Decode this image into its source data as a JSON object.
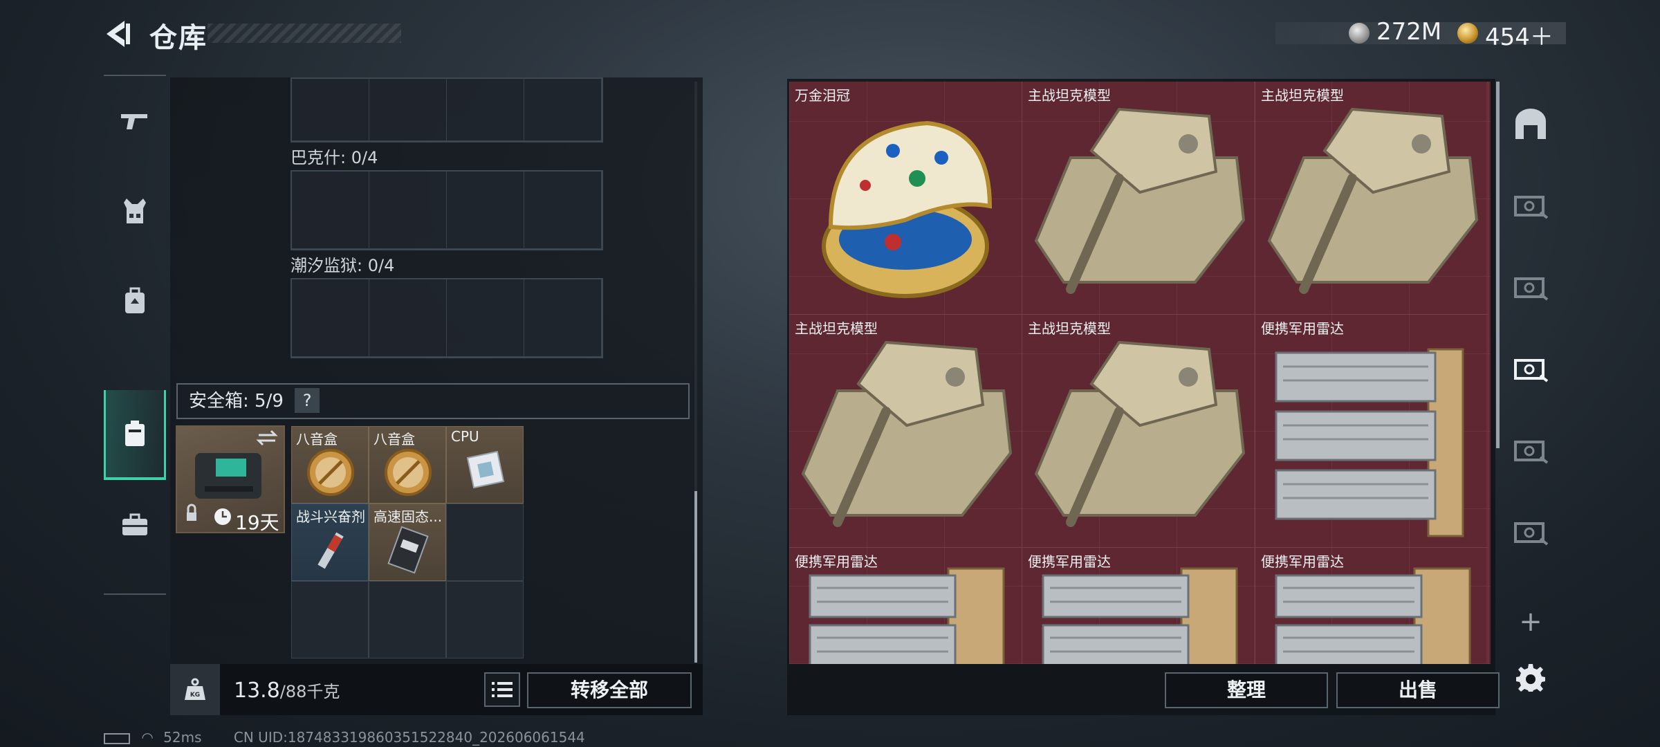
{
  "header": {
    "title": "仓库",
    "currencies": {
      "silver": "272M",
      "gold": "454＋"
    }
  },
  "left_panel": {
    "grids": [
      {
        "label": "巴克什: 0/4"
      },
      {
        "label": "潮汐监狱: 0/4"
      }
    ],
    "safe_box": {
      "label": "安全箱: 5/9",
      "help": "?",
      "days": "19天",
      "items": [
        {
          "name": "八音盒"
        },
        {
          "name": "八音盒"
        },
        {
          "name": "CPU"
        },
        {
          "name": "战斗兴奋剂"
        },
        {
          "name": "高速固态..."
        }
      ]
    },
    "weight": {
      "current": "13.8",
      "max": "/88千克"
    },
    "transfer_all_label": "转移全部"
  },
  "stash": {
    "items": [
      {
        "name": "万金泪冠"
      },
      {
        "name": "主战坦克模型"
      },
      {
        "name": "主战坦克模型"
      },
      {
        "name": "主战坦克模型"
      },
      {
        "name": "主战坦克模型"
      },
      {
        "name": "便携军用雷达"
      },
      {
        "name": "便携军用雷达"
      },
      {
        "name": "便携军用雷达"
      },
      {
        "name": "便携军用雷达"
      }
    ],
    "sort_label": "整理",
    "sell_label": "出售"
  },
  "right_rail": {
    "add_label": "+"
  },
  "status": {
    "ping": "52ms",
    "uid": "CN UID:18748331986035152284​0_202606061544"
  },
  "colors": {
    "accent": "#3fd1a8",
    "stash_bg": "#5e2731"
  }
}
